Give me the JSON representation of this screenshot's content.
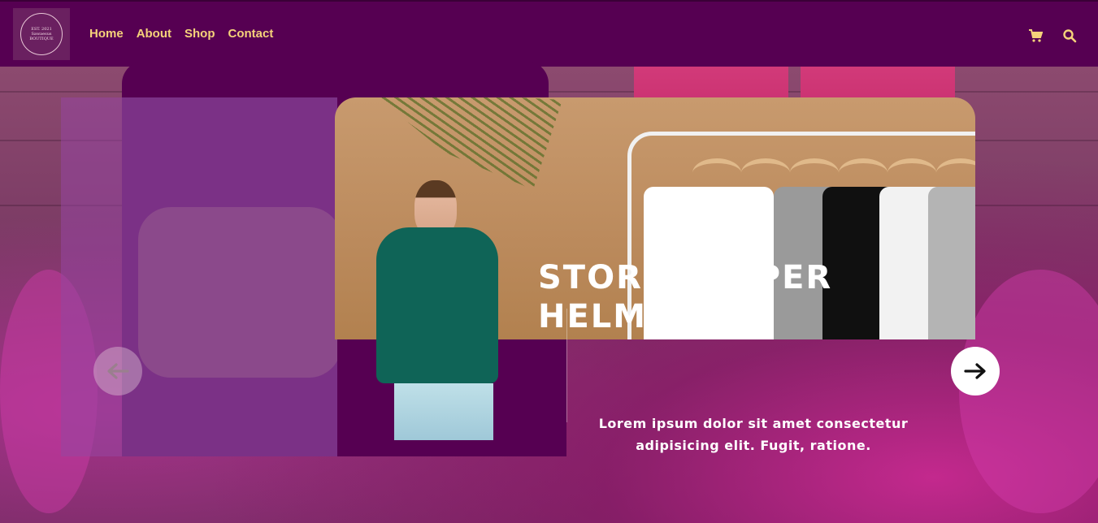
{
  "navbar": {
    "logo": {
      "line1": "EST. 2021",
      "line2": "Sawaesus",
      "line3": "BOUTIQUE"
    },
    "links": [
      "Home",
      "About",
      "Shop",
      "Contact"
    ],
    "icons": [
      "cart-icon",
      "search-icon"
    ]
  },
  "hero": {
    "title_line1": "STORMTROPER",
    "title_line2": "HELMET",
    "description_line1": "Lorem ipsum dolor sit amet consectetur",
    "description_line2": "adipisicing elit. Fugit, ratione.",
    "prev_icon": "arrow-left-icon",
    "next_icon": "arrow-right-icon"
  },
  "colors": {
    "navbar_bg": "#560052",
    "nav_link": "#f5d27a",
    "panel": "#560052",
    "shirt_colors": [
      "#ffffff",
      "#9a9a9a",
      "#101010",
      "#f2f2f2",
      "#b4b4b4"
    ]
  }
}
